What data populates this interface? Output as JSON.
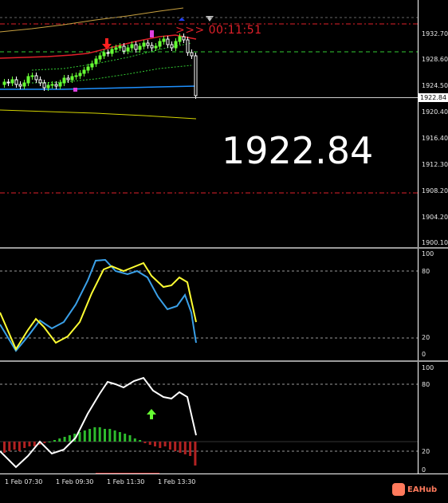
{
  "price_axis": [
    "1932.70",
    "1928.60",
    "1924.50",
    "1920.40",
    "1916.40",
    "1912.30",
    "1908.20",
    "1904.20",
    "1900.10"
  ],
  "current_price": "1922.84",
  "big_price": "1922.84",
  "timer_text": ">>> 00:11:51",
  "osc1_axis": [
    "100",
    "80",
    "20",
    "0"
  ],
  "osc2_axis": [
    "100",
    "80",
    "20",
    "0"
  ],
  "time_labels": [
    "1 Feb 07:30",
    "1 Feb 09:30",
    "1 Feb 11:30",
    "1 Feb 13:30"
  ],
  "watermark": "EAHub",
  "colors": {
    "bull": "#66ff33",
    "bear": "#ffffff",
    "ma_red": "#e0202a",
    "ma_blue": "#1e90ff",
    "ma_yellow": "#d4d400",
    "level_red": "#e0202a",
    "level_green": "#33cc33",
    "stoch_main": "#3aa0e8",
    "stoch_signal": "#ffff33",
    "hist_green": "#2dbb2d",
    "hist_red": "#b22222"
  }
}
